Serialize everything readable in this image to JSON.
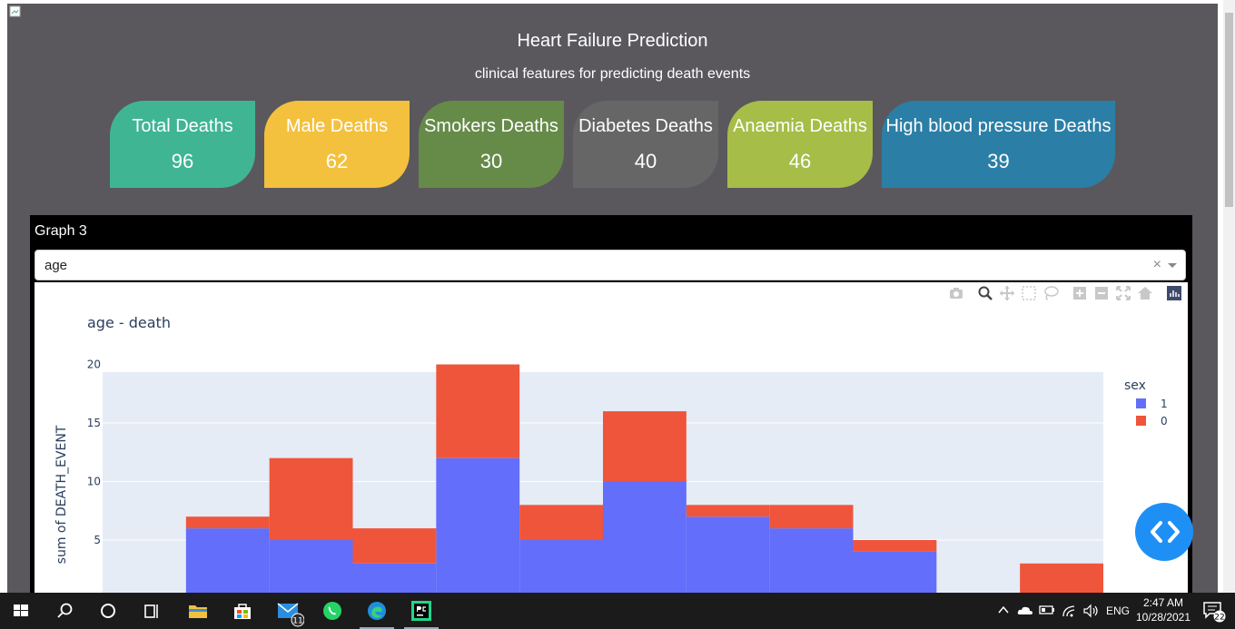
{
  "app": {
    "title": "Heart Failure Prediction",
    "subtitle": "clinical features for predicting death events"
  },
  "cards": [
    {
      "label": "Total Deaths",
      "value": "96",
      "color": "#3fb594"
    },
    {
      "label": "Male Deaths",
      "value": "62",
      "color": "#f4c13e"
    },
    {
      "label": "Smokers Deaths",
      "value": "30",
      "color": "#668b48"
    },
    {
      "label": "Diabetes Deaths",
      "value": "40",
      "color": "#666666"
    },
    {
      "label": "Anaemia Deaths",
      "value": "46",
      "color": "#a6bd48"
    },
    {
      "label": "High blood pressure Deaths",
      "value": "39",
      "color": "#2b7fa6"
    }
  ],
  "graph": {
    "label": "Graph 3",
    "dropdown": {
      "selected": "age",
      "clear": "×"
    }
  },
  "modebar": [
    "camera-icon",
    "zoom-icon",
    "pan-icon",
    "box-select-icon",
    "lasso-icon",
    "zoom-in-icon",
    "zoom-out-icon",
    "autoscale-icon",
    "reset-axes-icon",
    "plotly-logo-icon"
  ],
  "chart_data": {
    "type": "bar",
    "barmode": "stack",
    "title": "age - death",
    "ylabel": "sum of DEATH_EVENT",
    "xlabel": "",
    "ylim": [
      0,
      21
    ],
    "yticks": [
      5,
      10,
      15,
      20
    ],
    "visible_y_range": [
      3.3,
      21
    ],
    "legend": {
      "title": "sex",
      "placement": "top-right"
    },
    "bins": 12,
    "series": [
      {
        "name": "1",
        "color": "#636efa",
        "values": [
          0,
          6,
          5,
          3,
          12,
          5,
          10,
          7,
          6,
          4,
          0,
          0
        ]
      },
      {
        "name": "0",
        "color": "#ef553b",
        "values": [
          0,
          1,
          7,
          3,
          8,
          3,
          6,
          1,
          2,
          1,
          0,
          3
        ]
      }
    ]
  },
  "taskbar": {
    "mail_badge": "11",
    "language": "ENG",
    "time": "2:47 AM",
    "date": "10/28/2021",
    "notification_count": "22"
  }
}
